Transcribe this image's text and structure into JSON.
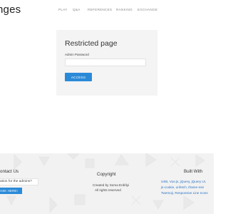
{
  "header": {
    "logo_text": "nges",
    "nav": {
      "play": "PLAY",
      "qa": "Q&A",
      "references": "REFERENCES",
      "ranking": "RANKING",
      "exchange": "EXCHANGE"
    }
  },
  "main": {
    "title": "Restricted page",
    "password_label": "Admin Password",
    "password_value": "",
    "access_label": "ACCESS"
  },
  "footer": {
    "contact": {
      "heading": "ontact Us",
      "box_text": "ation for the admins?",
      "ask_label": "ASK HERE!"
    },
    "copyright": {
      "heading": "Copyright",
      "line1": "Created by Soma Erdélyi",
      "line2": "All rights reserved"
    },
    "built_with": {
      "heading": "Built With",
      "lines": [
        "UIkit, Vue.js, jQuery, jQuery UI,",
        "js-cookie, unfetch, iframe-resi",
        "Twemoji, Responsive Line Icons"
      ]
    }
  },
  "colors": {
    "accent": "#2b8ad8",
    "card_bg": "#f4f4f4",
    "footer_bg": "#f2f2f2",
    "link": "#2b73c2"
  }
}
